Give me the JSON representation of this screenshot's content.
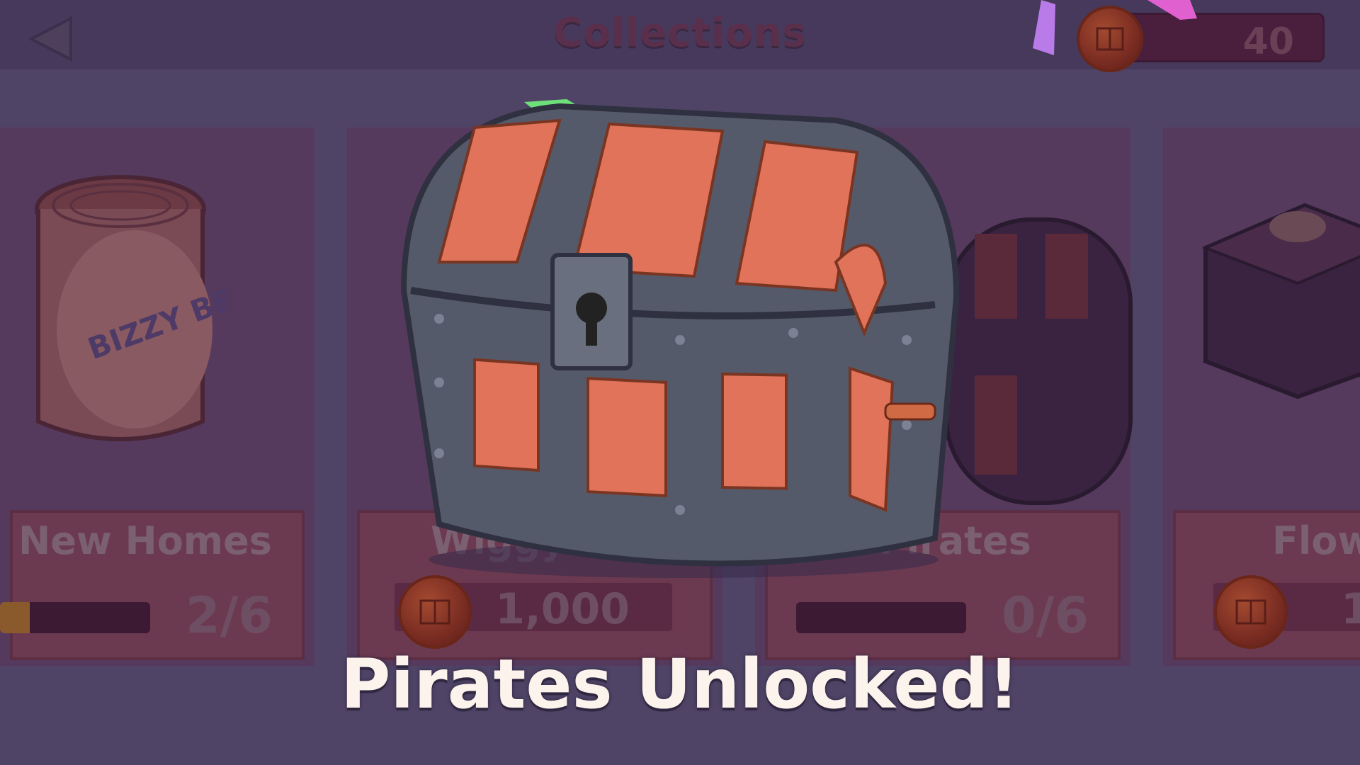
{
  "header": {
    "title": "Collections",
    "currency_amount": "40"
  },
  "cards": [
    {
      "label": "New Homes",
      "type": "progress",
      "count": "2/6",
      "progress": 0.2
    },
    {
      "label": "Wiggy Wit It",
      "type": "price",
      "price": "1,000"
    },
    {
      "label": "Pirates",
      "type": "progress",
      "count": "0/6",
      "progress": 0.0
    },
    {
      "label": "Flow",
      "type": "price",
      "price": "1"
    }
  ],
  "unlock_message": "Pirates Unlocked!",
  "can_text": "BIZZY BE HONE",
  "icons": [
    "back-arrow-icon",
    "coin-icon",
    "treasure-chest-icon",
    "honey-can-icon",
    "gift-box-icon"
  ],
  "colors": {
    "overlay": "#4f4466",
    "message_text": "#fbf3ec",
    "chest_wood": "#e0735a",
    "chest_metal": "#555a6a"
  }
}
